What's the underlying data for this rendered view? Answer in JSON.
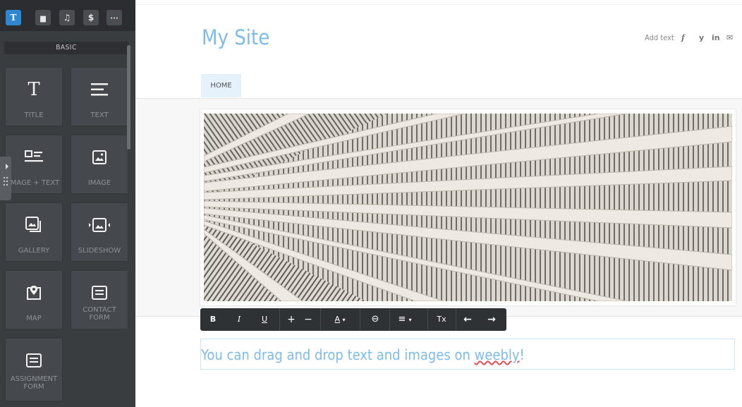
{
  "sidebar": {
    "tabs": [
      {
        "label": "T",
        "icon": "title-icon",
        "active": true
      },
      {
        "label": "▆",
        "icon": "layout-icon",
        "active": false
      },
      {
        "label": "♫",
        "icon": "music-icon",
        "active": false
      },
      {
        "label": "$",
        "icon": "dollar-icon",
        "active": false
      },
      {
        "label": "···",
        "icon": "more-icon",
        "active": false
      }
    ],
    "section_label": "BASIC",
    "elements": [
      {
        "label": "TITLE",
        "icon": "title-icon"
      },
      {
        "label": "TEXT",
        "icon": "text-lines-icon"
      },
      {
        "label": "IMAGE + TEXT",
        "icon": "image-text-icon"
      },
      {
        "label": "IMAGE",
        "icon": "image-icon"
      },
      {
        "label": "GALLERY",
        "icon": "gallery-icon"
      },
      {
        "label": "SLIDESHOW",
        "icon": "slideshow-icon"
      },
      {
        "label": "MAP",
        "icon": "map-pin-icon"
      },
      {
        "label": "CONTACT FORM",
        "label_line1": "CONTACT",
        "label_line2": "FORM",
        "icon": "form-icon"
      },
      {
        "label": "ASSIGNMENT FORM",
        "label_line1": "ASSIGNMENT",
        "label_line2": "FORM",
        "icon": "form-icon"
      }
    ]
  },
  "header": {
    "site_title": "My Site",
    "add_text": "Add text",
    "social": [
      "f",
      "y",
      "in",
      "✉"
    ]
  },
  "nav": {
    "items": [
      "HOME"
    ]
  },
  "toolbar": {
    "bold": "B",
    "italic": "I",
    "underline": "U",
    "increase": "+",
    "decrease": "−",
    "font_color": "A",
    "font_color_arrow": "▾",
    "link": "⊖",
    "align": "≡",
    "align_arrow": "▾",
    "clear": "Tx",
    "undo": "←",
    "redo": "→"
  },
  "content": {
    "paragraph_part1": "You can drag and drop text and images on ",
    "paragraph_part2": "weebly",
    "paragraph_part3": "!"
  },
  "colors": {
    "accent": "#7ebce8",
    "sidebar_bg": "#3a3d40",
    "active_tab": "#2f86d1",
    "toolbar_bg": "#2f3235"
  }
}
